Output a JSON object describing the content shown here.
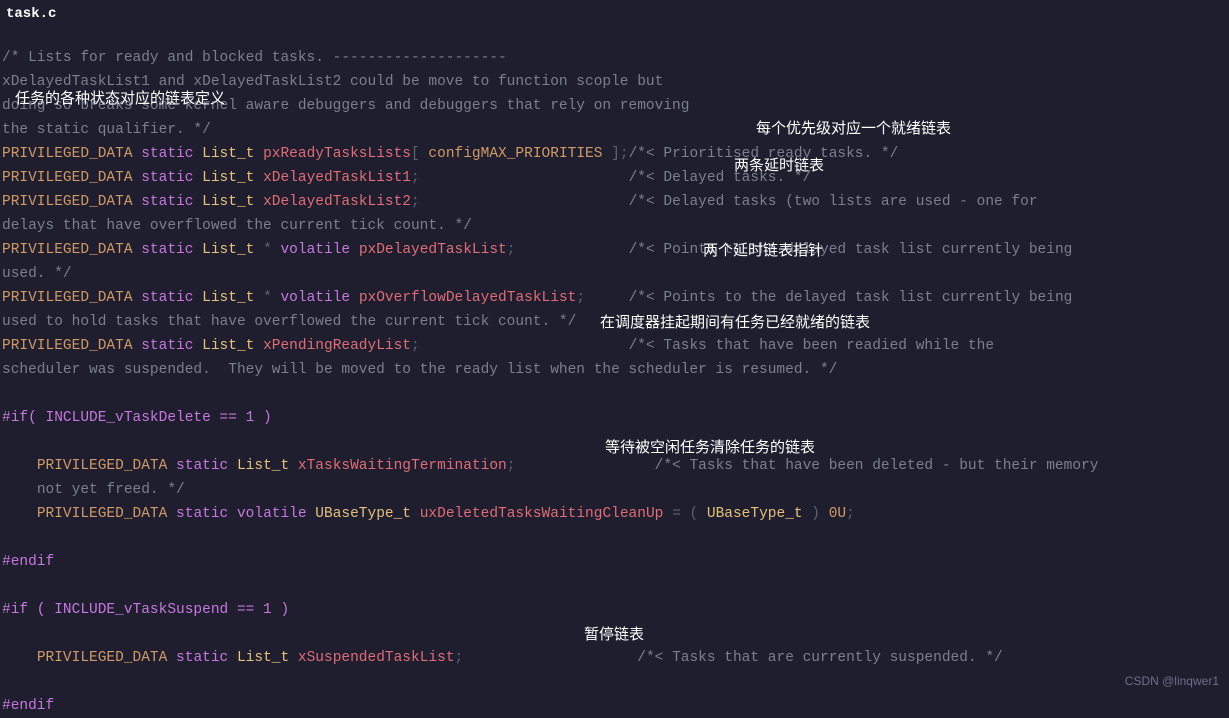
{
  "filename": "task.c",
  "watermark": "CSDN @linqwer1",
  "code": {
    "c1": "/* Lists for ready and blocked tasks. --------------------",
    "c2": "xDelayedTaskList1 and xDelayedTaskList2 could be move to function scople but",
    "c3": "doing so breaks some kernel aware debuggers and debuggers that rely on removing",
    "c4": "the static qualifier. */",
    "priv": "PRIVILEGED_DATA",
    "kw_static": "static",
    "t_list": "List_t",
    "t_ubase": "UBaseType_t",
    "kw_volatile": "volatile",
    "v_ready": "pxReadyTasksLists",
    "v_brak_l": "[",
    "v_brak_val": "configMAX_PRIORITIES",
    "v_brak_r": "]",
    "semi": ";",
    "c_ready": "/*< Prioritised ready tasks. */",
    "v_del1": "xDelayedTaskList1",
    "c_del1": "/*< Delayed tasks. */",
    "v_del2": "xDelayedTaskList2",
    "c_del2": "/*< Delayed tasks (two lists are used - one for",
    "c_del2b": "delays that have overflowed the current tick count. */",
    "star": "*",
    "v_pxdel": "pxDelayedTaskList",
    "c_pxdel": "/*< Points to the delayed task list currently being",
    "c_used": "used. */",
    "v_pxov": "pxOverflowDelayedTaskList",
    "c_pxov": "/*< Points to the delayed task list currently being",
    "c_pxov2": "used to hold tasks that have overflowed the current tick count. */",
    "v_pend": "xPendingReadyList",
    "c_pend1": "/*< Tasks that have been readied while the",
    "c_pend2": "scheduler was suspended.  They will be moved to the ready list when the scheduler is resumed. */",
    "pp_if1": "#if( INCLUDE_vTaskDelete == 1 )",
    "v_wait": "xTasksWaitingTermination",
    "c_wait": "/*< Tasks that have been deleted - but their memory",
    "c_wait2": "not yet freed. */",
    "v_clean": "uxDeletedTasksWaitingCleanUp",
    "eq": "=",
    "paren_l": "(",
    "paren_r": ")",
    "zero": "0U",
    "pp_endif": "#endif",
    "pp_if2": "#if ( INCLUDE_vTaskSuspend == 1 )",
    "v_susp": "xSuspendedTaskList",
    "c_susp": "/*< Tasks that are currently suspended. */"
  },
  "annotations": {
    "a1": "任务的各种状态对应的链表定义",
    "a2": "每个优先级对应一个就绪链表",
    "a3": "两条延时链表",
    "a4": "两个延时链表指针",
    "a5": "在调度器挂起期间有任务已经就绪的链表",
    "a6": "等待被空闲任务清除任务的链表",
    "a7": "暂停链表"
  }
}
